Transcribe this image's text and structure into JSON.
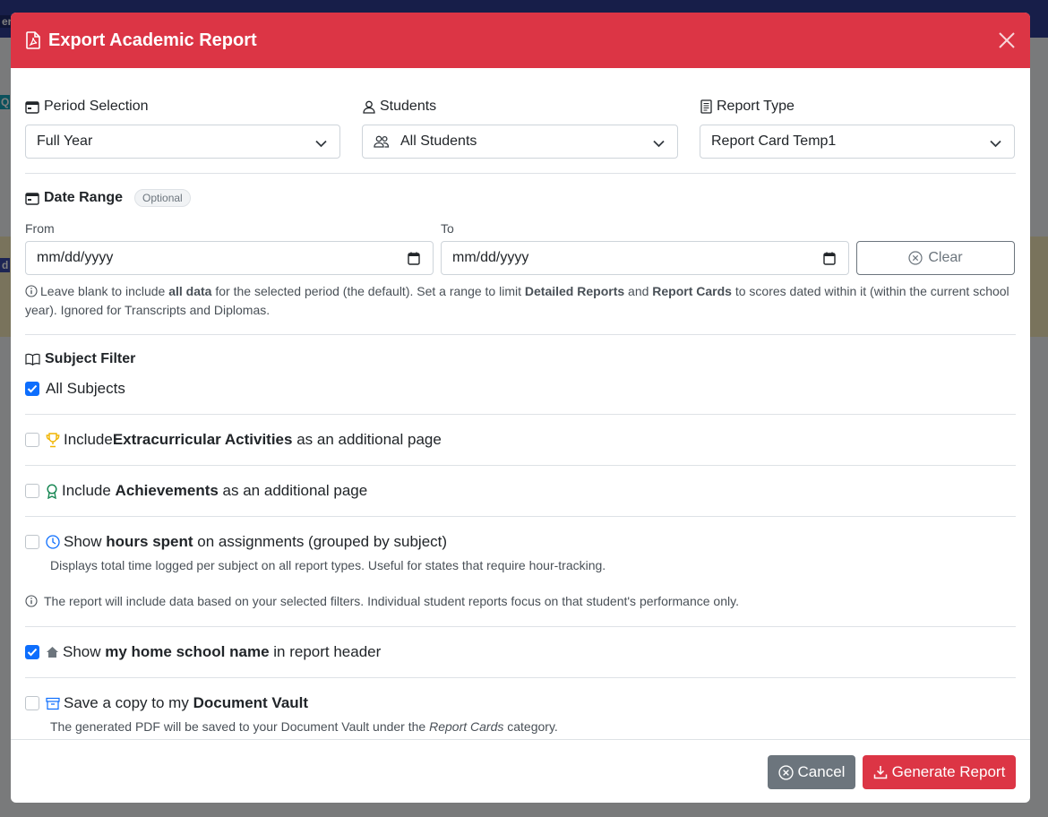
{
  "background": {
    "fragments": [
      "er",
      "Q",
      "d"
    ]
  },
  "modal": {
    "title": "Export Academic Report"
  },
  "period": {
    "label": "Period Selection",
    "value": "Full Year"
  },
  "students": {
    "label": "Students",
    "value": "All Students"
  },
  "report_type": {
    "label": "Report Type",
    "value": "Report Card Temp1"
  },
  "date_range": {
    "label": "Date Range",
    "badge": "Optional",
    "from_label": "From",
    "to_label": "To",
    "from_placeholder": "mm/dd/yyyy",
    "to_placeholder": "mm/dd/yyyy",
    "clear_label": "Clear",
    "help": {
      "t1": "Leave blank to include ",
      "b1": "all data",
      "t2": " for the selected period (the default). Set a range to limit ",
      "b2": "Detailed Reports",
      "t3": " and ",
      "b3": "Report Cards",
      "t4": " to scores dated within it (within the current school year). Ignored for Transcripts and Diplomas."
    }
  },
  "subject_filter": {
    "label": "Subject Filter",
    "all_subjects": "All Subjects"
  },
  "options": {
    "extracurricular": {
      "pre": "Include ",
      "bold": "Extracurricular Activities",
      "post": " as an additional page"
    },
    "achievements": {
      "pre": "Include ",
      "bold": "Achievements",
      "post": " as an additional page"
    },
    "hours": {
      "pre": "Show ",
      "bold": "hours spent",
      "post": " on assignments (grouped by subject)",
      "help": "Displays total time logged per subject on all report types. Useful for states that require hour-tracking."
    },
    "info": "The report will include data based on your selected filters. Individual student reports focus on that student's performance only.",
    "school_name": {
      "pre": "Show ",
      "bold": "my home school name",
      "post": " in report header"
    },
    "vault": {
      "pre": "Save a copy to my ",
      "bold": "Document Vault",
      "help_pre": "The generated PDF will be saved to your Document Vault under the ",
      "help_em": "Report Cards",
      "help_post": " category."
    }
  },
  "footer": {
    "cancel_label": "Cancel",
    "generate_label": "Generate Report"
  },
  "colors": {
    "danger": "#dc3545",
    "primary": "#0d6efd",
    "secondary": "#6c757d",
    "trophy": "#f0b400",
    "award": "#198754",
    "clock": "#0d6efd"
  }
}
